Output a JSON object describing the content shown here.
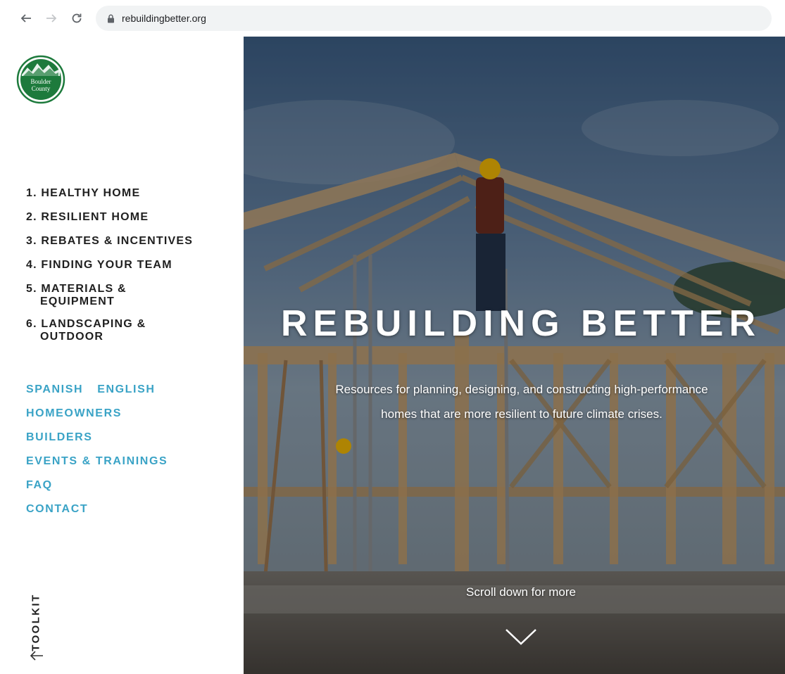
{
  "browser": {
    "url": "rebuildingbetter.org"
  },
  "sidebar": {
    "logo": {
      "text_line1": "Boulder",
      "text_line2": "County",
      "color": "#1d7a3c"
    },
    "main_nav": [
      {
        "label": "1. HEALTHY HOME"
      },
      {
        "label": "2. RESILIENT HOME"
      },
      {
        "label": "3. REBATES & INCENTIVES"
      },
      {
        "label": "4. FINDING YOUR TEAM"
      },
      {
        "label_line1": "5. MATERIALS &",
        "label_line2": "EQUIPMENT"
      },
      {
        "label_line1": "6. LANDSCAPING &",
        "label_line2": "OUTDOOR"
      }
    ],
    "languages": {
      "spanish": "SPANISH",
      "english": "ENGLISH"
    },
    "sub_nav": [
      {
        "label": "HOMEOWNERS"
      },
      {
        "label": "BUILDERS"
      },
      {
        "label": "EVENTS & TRAININGS"
      },
      {
        "label": "FAQ"
      },
      {
        "label": "CONTACT"
      }
    ],
    "toolkit_label": "TOOLKIT",
    "accent_color": "#3aa3c6"
  },
  "hero": {
    "title": "REBUILDING BETTER",
    "subtitle_line1": "Resources for planning, designing, and constructing high-performance",
    "subtitle_line2": "homes that are more resilient to future climate crises.",
    "scroll_label": "Scroll down for more"
  }
}
